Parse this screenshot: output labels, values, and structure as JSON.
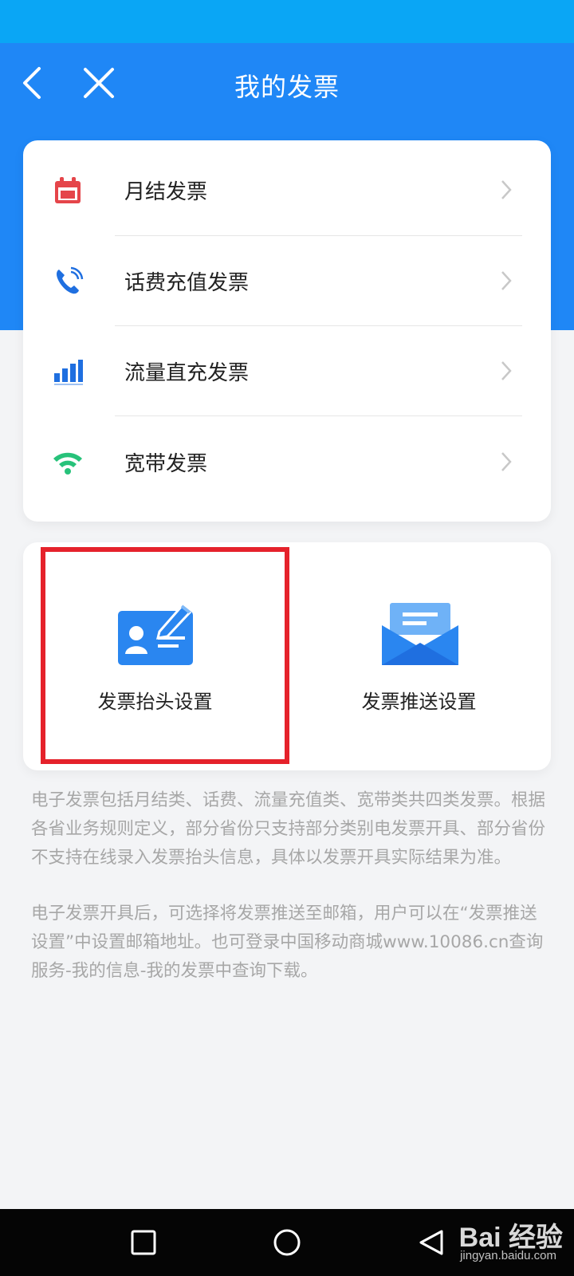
{
  "header": {
    "title": "我的发票",
    "back_icon": "back-chevron-icon",
    "close_icon": "close-icon"
  },
  "invoice_types": [
    {
      "label": "月结发票",
      "icon": "calendar-icon",
      "color": "#e5454a"
    },
    {
      "label": "话费充值发票",
      "icon": "phone-call-icon",
      "color": "#1f6fe0"
    },
    {
      "label": "流量直充发票",
      "icon": "signal-bars-icon",
      "color": "#1f6fe0"
    },
    {
      "label": "宽带发票",
      "icon": "wifi-icon",
      "color": "#27c27a"
    }
  ],
  "settings": [
    {
      "label": "发票抬头设置",
      "icon": "id-card-edit-icon",
      "highlighted": true
    },
    {
      "label": "发票推送设置",
      "icon": "envelope-icon",
      "highlighted": false
    }
  ],
  "notes": [
    "电子发票包括月结类、话费、流量充值类、宽带类共四类发票。根据各省业务规则定义，部分省份只支持部分类别电发票开具、部分省份不支持在线录入发票抬头信息，具体以发票开具实际结果为准。",
    "电子发票开具后，可选择将发票推送至邮箱，用户可以在“发票推送设置”中设置邮箱地址。也可登录中国移动商城www.10086.cn查询服务-我的信息-我的发票中查询下载。"
  ],
  "system_nav": [
    "recent-apps-icon",
    "home-icon",
    "back-triangle-icon"
  ],
  "watermark": {
    "main": "Bai 经验",
    "sub": "jingyan.baidu.com"
  },
  "colors": {
    "status_bar": "#0aa6f5",
    "header": "#1f87f6",
    "highlight": "#e5222b",
    "note_text": "#a7a7a7"
  }
}
